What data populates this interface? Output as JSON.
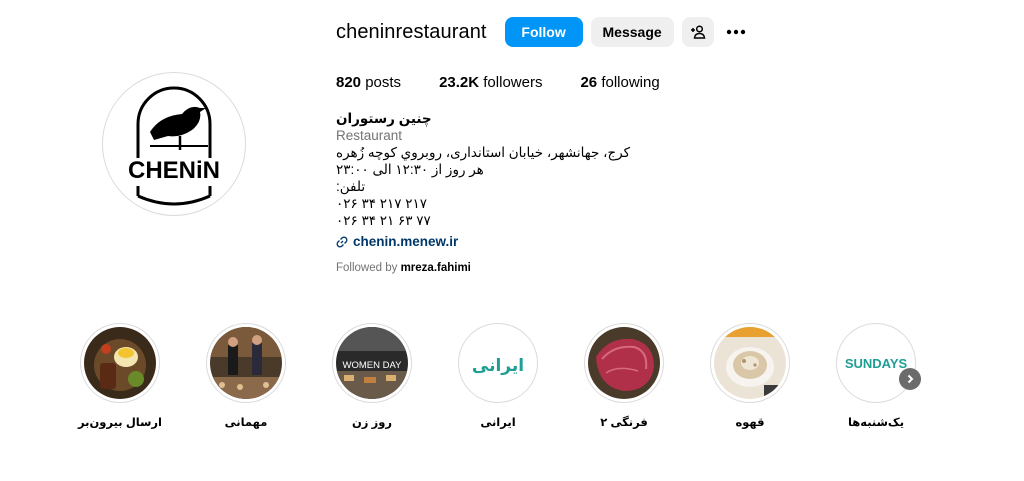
{
  "profile": {
    "username": "cheninrestaurant",
    "follow_label": "Follow",
    "message_label": "Message",
    "avatar_text": "CHENiN"
  },
  "stats": {
    "posts_count": "820",
    "posts_label": "posts",
    "followers_count": "23.2K",
    "followers_label": "followers",
    "following_count": "26",
    "following_label": "following"
  },
  "bio": {
    "name": "چنین رستوران",
    "category": "Restaurant",
    "lines": [
      "کرج، جهانشهر، خیابان استانداری، روبروي کوچه زُهره",
      "هر روز از ۱۲:۳۰ الی ۲۳:۰۰",
      "تلفن:",
      "۰۲۶ ۳۴ ۲۱۷ ۲۱۷",
      "۰۲۶ ۳۴ ۲۱ ۶۳ ۷۷"
    ],
    "link": "chenin.menew.ir",
    "followed_by_prefix": "Followed by",
    "followed_by_user": "mreza.fahimi"
  },
  "highlights": [
    {
      "label": "ارسال بیرون‌بر",
      "icon": "food-plate-photo"
    },
    {
      "label": "مهمانی",
      "icon": "party-photo"
    },
    {
      "label": "روز زن",
      "icon": "women-day-photo",
      "overlay_text": "WOMEN DAY"
    },
    {
      "label": "ایرانی",
      "icon": "iranian-text-cover",
      "overlay_text": "ایرانی"
    },
    {
      "label": "فرنگی ۲",
      "icon": "steak-photo"
    },
    {
      "label": "قهوه",
      "icon": "coffee-photo"
    },
    {
      "label": "یک‌شنبه‌ها",
      "icon": "sundays-text-cover",
      "overlay_text": "SUNDAYS"
    }
  ],
  "colors": {
    "accent": "#0095f6",
    "teal_highlight": "#1f9e95",
    "link": "#00376b",
    "muted": "#737373"
  }
}
